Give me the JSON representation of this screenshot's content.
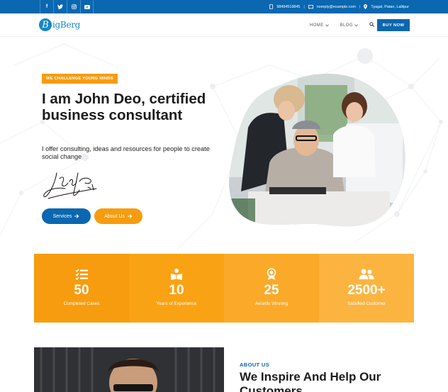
{
  "topbar": {
    "social": [
      {
        "icon": "facebook-icon",
        "glyph": "f"
      },
      {
        "icon": "twitter-icon",
        "glyph": "t"
      },
      {
        "icon": "instagram-icon",
        "glyph": "◎"
      },
      {
        "icon": "youtube-icon",
        "glyph": "▶"
      }
    ],
    "phone": "98494519845",
    "email": "noreply@example.com",
    "location": "Tyagal, Patan, Lalitpur"
  },
  "header": {
    "logo_mark": "B",
    "logo_text": "igBerg",
    "nav": [
      {
        "label": "HOME"
      },
      {
        "label": "BLOG"
      }
    ],
    "buy_label": "BUY NOW"
  },
  "hero": {
    "tagline": "WE CHALLENGE YOUNG MINDS",
    "title": "I am John Deo, certified business consultant",
    "description": "I offer consulting, ideas and resources for people to create social change",
    "services_label": "Services",
    "about_label": "About Us"
  },
  "stats": [
    {
      "value": "50",
      "label": "Completed Cases",
      "icon": "checklist-icon",
      "color": "#f79c0e"
    },
    {
      "value": "10",
      "label": "Years of Experience",
      "icon": "book-icon",
      "color": "#f9a314"
    },
    {
      "value": "25",
      "label": "Awards Winning",
      "icon": "award-icon",
      "color": "#faaa28"
    },
    {
      "value": "2500+",
      "label": "Satisfied Customer",
      "icon": "users-icon",
      "color": "#fbb43f"
    }
  ],
  "about": {
    "tag": "ABOUT US",
    "title": "We Inspire And Help Our Customers"
  },
  "colors": {
    "primary": "#0a67b0",
    "accent": "#f79c0e"
  }
}
